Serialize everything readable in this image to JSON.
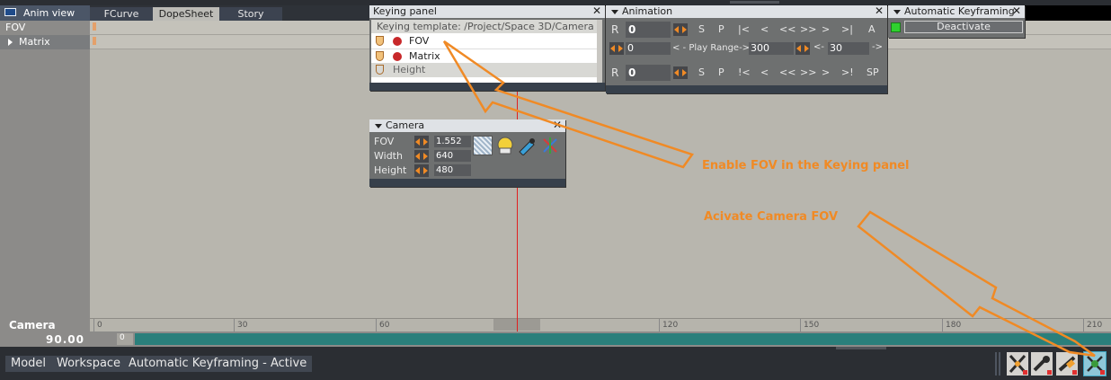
{
  "outline": {
    "title": "Anim view",
    "fov_label": "FOV",
    "matrix_label": "Matrix",
    "camera_label": "Camera",
    "fov_value": "90.00"
  },
  "tabs": [
    {
      "label": "FCurve"
    },
    {
      "label": "DopeSheet"
    },
    {
      "label": "Story"
    }
  ],
  "ruler": {
    "ticks": [
      "0",
      "30",
      "60",
      "90",
      "120",
      "150",
      "180",
      "210"
    ],
    "frame_start": "0"
  },
  "keying_panel": {
    "title": "Keying panel",
    "template": "Keying template: /Project/Space 3D/Camera",
    "items": [
      {
        "label": "FOV"
      },
      {
        "label": "Matrix"
      },
      {
        "label": "Height"
      }
    ]
  },
  "animation_panel": {
    "title": "Animation",
    "row1": {
      "r": "R",
      "value": "0",
      "buttons": [
        "S",
        "P",
        "|<",
        "<",
        "<<",
        ">>",
        ">",
        ">|",
        "A"
      ]
    },
    "row2": {
      "start": "0",
      "play_range": "< - Play Range->",
      "end": "300",
      "step_sep": "<-",
      "step": "30",
      "step_end": "->"
    },
    "row3": {
      "r": "R",
      "value": "0",
      "buttons": [
        "S",
        "P",
        "!<",
        "<",
        "<<",
        ">>",
        ">",
        ">!",
        "SP"
      ]
    }
  },
  "auto_keyframing": {
    "title": "Automatic Keyframing",
    "button": "Deactivate"
  },
  "camera_panel": {
    "title": "Camera",
    "fields": [
      {
        "label": "FOV",
        "value": "1.552"
      },
      {
        "label": "Width",
        "value": "640"
      },
      {
        "label": "Height",
        "value": "480"
      }
    ]
  },
  "annotations": {
    "keying": "Enable FOV in the Keying panel",
    "camera": "Acivate Camera FOV"
  },
  "statusbar": {
    "model": "Model",
    "workspace": "Workspace",
    "auto": "Automatic Keyframing - Active"
  },
  "colors": {
    "accent_orange": "#f08a25",
    "playhead": "#e02020",
    "timeline": "#2a7f7b"
  }
}
